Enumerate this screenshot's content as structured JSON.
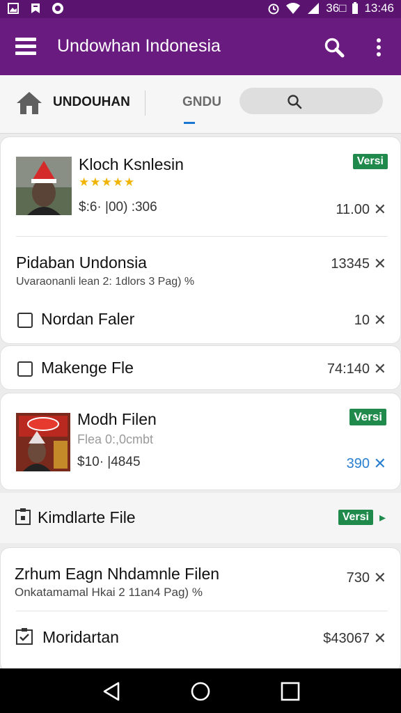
{
  "status_bar": {
    "time": "13:46",
    "signal_text": "36□",
    "icons": [
      "image-icon",
      "notification-icon",
      "chat-icon",
      "alarm-icon",
      "wifi-icon",
      "signal-icon",
      "battery-icon"
    ]
  },
  "app_bar": {
    "title": "Undowhan Indonesia",
    "icons": [
      "menu-icon",
      "search-icon",
      "more-vert-icon"
    ],
    "color": "#6a1b80"
  },
  "tabs": {
    "home_label": "UNDOUHAN",
    "second_label": "GNDU",
    "indicator_color": "#1976d2"
  },
  "items": {
    "item1": {
      "title": "Kloch Ksnlesin",
      "rating": "★★★★★",
      "price": "$:6· |00) :306",
      "badge": "Versi",
      "amount": "11.00",
      "close": "✕"
    },
    "item2": {
      "title": "Pidaban Undonsia",
      "subtitle": "Uvaraonanli lean 2: 1dlors 3 Pag) %",
      "amount": "13345",
      "close": "✕"
    },
    "item3": {
      "title": "Nordan Faler",
      "amount": "10",
      "close": "✕"
    },
    "item4": {
      "title": "Makenge Fle",
      "amount": "74:140",
      "close": "✕"
    },
    "item5": {
      "title": "Modh Filen",
      "subtitle": "Flea 0:,0cmbt",
      "price": "$10· |4845",
      "badge": "Versi",
      "amount": "390",
      "close": "✕"
    },
    "item6": {
      "title": "Kimdlarte File",
      "badge": "Versi",
      "arrow": "▸"
    },
    "item7": {
      "title": "Zrhum Eagn Nhdamnle Filen",
      "subtitle": "Onkatamamal Hkai  2 11an4 Pag) %",
      "amount": "730",
      "close": "✕"
    },
    "item8": {
      "title": "Moridartan",
      "amount": "$43067",
      "close": "✕"
    }
  },
  "colors": {
    "badge": "#1f8a4c",
    "accent_blue": "#2a7fd0",
    "star": "#f0b400"
  },
  "nav": {
    "icons": [
      "back-icon",
      "home-circle-icon",
      "recents-icon"
    ]
  }
}
